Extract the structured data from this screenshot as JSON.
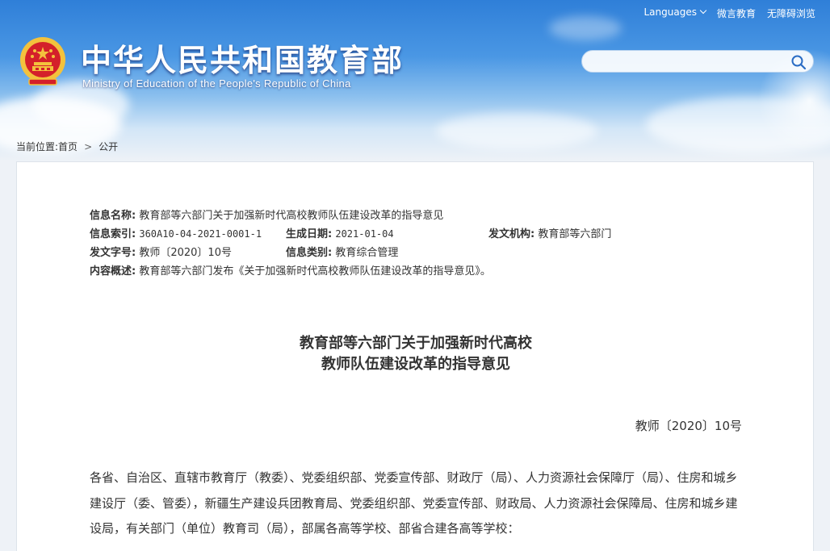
{
  "header": {
    "site_title": "中华人民共和国教育部",
    "site_subtitle": "Ministry of Education of the People's Republic of China",
    "links": {
      "languages": "Languages",
      "weiyan": "微言教育",
      "accessible": "无障碍浏览"
    },
    "search_placeholder": ""
  },
  "breadcrumb": {
    "label": "当前位置:",
    "home": "首页",
    "current": "公开"
  },
  "meta": {
    "name_label": "信息名称:",
    "name_value": "教育部等六部门关于加强新时代高校教师队伍建设改革的指导意见",
    "index_label": "信息索引:",
    "index_value": "360A10-04-2021-0001-1",
    "date_label": "生成日期:",
    "date_value": "2021-01-04",
    "issuer_label": "发文机构:",
    "issuer_value": "教育部等六部门",
    "docno_label": "发文字号:",
    "docno_value": "教师〔2020〕10号",
    "category_label": "信息类别:",
    "category_value": "教育综合管理",
    "summary_label": "内容概述:",
    "summary_value": "教育部等六部门发布《关于加强新时代高校教师队伍建设改革的指导意见》。"
  },
  "document": {
    "title_line1": "教育部等六部门关于加强新时代高校",
    "title_line2": "教师队伍建设改革的指导意见",
    "number": "教师〔2020〕10号",
    "body": "各省、自治区、直辖市教育厅（教委）、党委组织部、党委宣传部、财政厅（局）、人力资源社会保障厅（局）、住房和城乡建设厅（委、管委），新疆生产建设兵团教育局、党委组织部、党委宣传部、财政局、人力资源社会保障局、住房和城乡建设局，有关部门（单位）教育司（局），部属各高等学校、部省合建各高等学校："
  },
  "colors": {
    "sky_top": "#2f7fd8",
    "emblem_red": "#d4202a",
    "emblem_gold": "#f3c23d"
  }
}
